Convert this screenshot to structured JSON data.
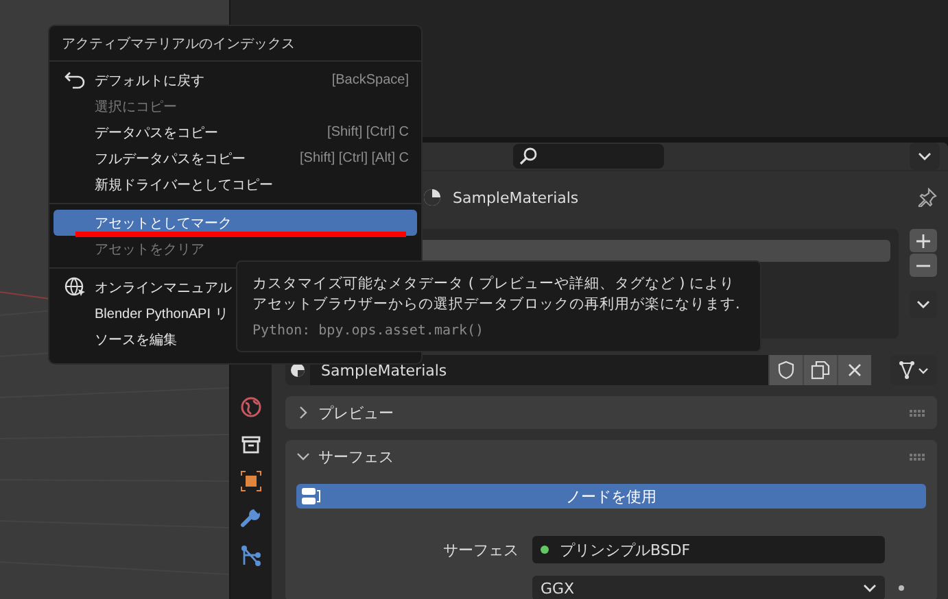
{
  "menu": {
    "title": "アクティブマテリアルのインデックス",
    "sections": [
      [
        {
          "label": "デフォルトに戻す",
          "shortcut": "[BackSpace]",
          "disabled": false,
          "selected": false
        },
        {
          "label": "選択にコピー",
          "disabled": true,
          "selected": false
        },
        {
          "label": "データパスをコピー",
          "shortcut": "[Shift] [Ctrl] C",
          "disabled": false,
          "selected": false
        },
        {
          "label": "フルデータパスをコピー",
          "shortcut": "[Shift] [Ctrl] [Alt] C",
          "disabled": false,
          "selected": false
        },
        {
          "label": "新規ドライバーとしてコピー",
          "disabled": false,
          "selected": false
        }
      ],
      [
        {
          "label": "アセットとしてマーク",
          "disabled": false,
          "selected": true,
          "marked": true
        },
        {
          "label": "アセットをクリア",
          "disabled": true,
          "selected": false
        }
      ],
      [
        {
          "label": "オンラインマニュアル",
          "disabled": false,
          "selected": false
        },
        {
          "label": "Blender PythonAPI リ",
          "disabled": false,
          "selected": false
        },
        {
          "label": "ソースを編集",
          "disabled": false,
          "selected": false
        }
      ]
    ]
  },
  "tooltip": {
    "lines": [
      "カスタマイズ可能なメタデータ ( プレビューや詳細、タグなど ) により",
      "アセットブラウザーからの選択データブロックの再利用が楽になります."
    ],
    "python": "Python: bpy.ops.asset.mark()"
  },
  "properties": {
    "material_name": "SampleMaterials",
    "datablock": "SampleMaterials",
    "panels": [
      {
        "title": "プレビュー",
        "expanded": false
      },
      {
        "title": "サーフェス",
        "expanded": true
      }
    ],
    "use_nodes_button": "ノードを使用",
    "surface": {
      "label": "サーフェス",
      "value": "プリンシプルBSDF"
    },
    "distribution": "GGX"
  }
}
